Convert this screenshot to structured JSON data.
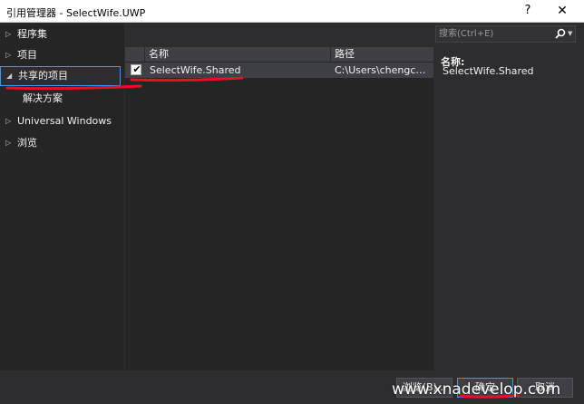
{
  "window": {
    "title": "引用管理器 - SelectWife.UWP",
    "help_glyph": "?",
    "close_glyph": "✕"
  },
  "nav": {
    "items": [
      {
        "label": "程序集",
        "arrow": "▷"
      },
      {
        "label": "项目",
        "arrow": "▷"
      },
      {
        "label": "共享的项目",
        "arrow": "◢"
      },
      {
        "label": "解决方案",
        "arrow": ""
      },
      {
        "label": "Universal Windows",
        "arrow": "▷"
      },
      {
        "label": "浏览",
        "arrow": "▷"
      }
    ]
  },
  "search": {
    "placeholder": "搜索(Ctrl+E)"
  },
  "list": {
    "columns": {
      "name": "名称",
      "path": "路径"
    },
    "rows": [
      {
        "checked": true,
        "check_glyph": "✔",
        "name": "SelectWife.Shared",
        "path": "C:\\Users\\chengcong\\..."
      }
    ]
  },
  "details": {
    "label": "名称:",
    "value": "SelectWife.Shared"
  },
  "buttons": {
    "browse": "浏览(B)...",
    "ok": "确定",
    "cancel": "取消"
  },
  "watermark": "www.xnadevelop.com",
  "colors": {
    "annotation_red": "#e81123",
    "selection_blue": "#3399ff"
  }
}
